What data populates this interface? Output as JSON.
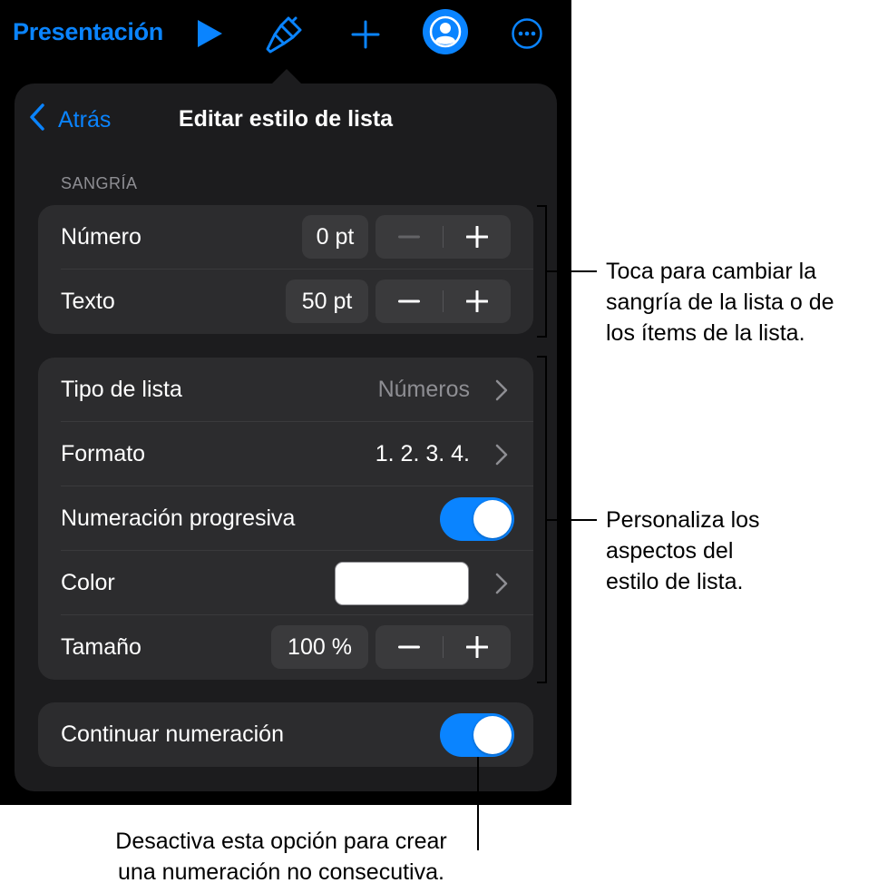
{
  "toolbar": {
    "title": "Presentación",
    "icons": [
      "play-icon",
      "paintbrush-icon",
      "plus-icon",
      "collaboration-icon",
      "more-icon"
    ],
    "accent": "#0a84ff"
  },
  "nav": {
    "back_label": "Atrás",
    "title": "Editar estilo de lista"
  },
  "indent": {
    "header": "SANGRÍA",
    "number": {
      "label": "Número",
      "value": "0 pt"
    },
    "text": {
      "label": "Texto",
      "value": "50 pt"
    }
  },
  "style": {
    "list_type": {
      "label": "Tipo de lista",
      "value": "Números"
    },
    "format": {
      "label": "Formato",
      "value": "1. 2. 3. 4."
    },
    "tiered": {
      "label": "Numeración progresiva",
      "on": true
    },
    "color": {
      "label": "Color",
      "swatch": "#ffffff"
    },
    "size": {
      "label": "Tamaño",
      "value": "100 %"
    }
  },
  "continue": {
    "label": "Continuar numeración",
    "on": true
  },
  "callouts": {
    "indent": "Toca para cambiar la sangría de la lista o de los ítems de la lista.",
    "style": "Personaliza los aspectos del estilo de lista.",
    "continue": "Desactiva esta opción para crear una numeración no consecutiva."
  },
  "callout_lines": {
    "indent": [
      "Toca para cambiar la",
      "sangría de la lista o de",
      "los ítems de la lista."
    ],
    "style": [
      "Personaliza los",
      "aspectos del",
      "estilo de lista."
    ],
    "continue": [
      "Desactiva esta opción para crear",
      "una numeración no consecutiva."
    ]
  }
}
